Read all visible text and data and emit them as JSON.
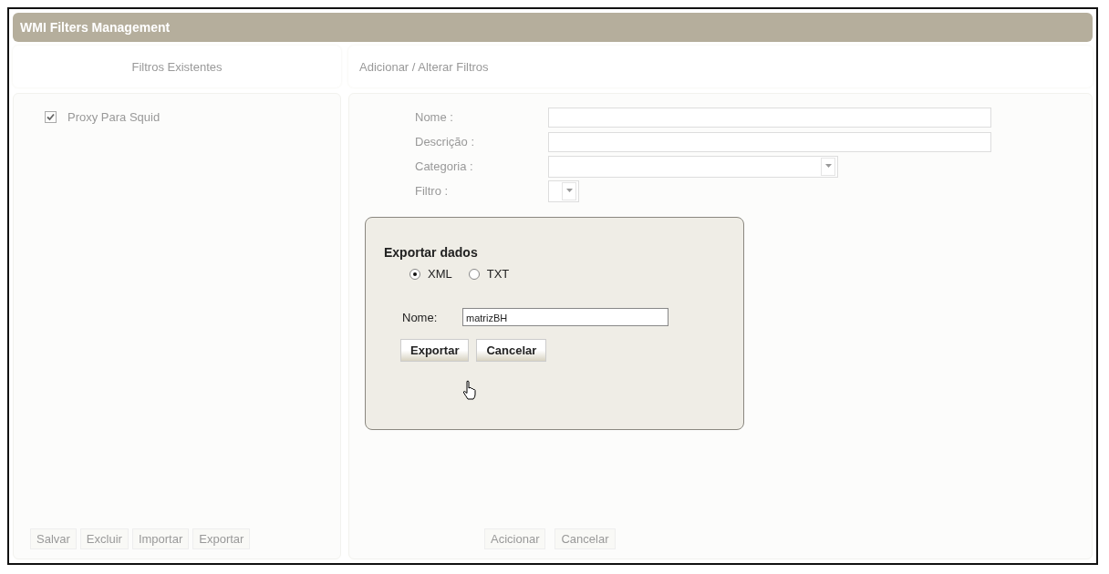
{
  "window": {
    "title": "WMI Filters Management"
  },
  "left_panel": {
    "heading": "Filtros Existentes",
    "items": [
      {
        "label": "Proxy Para Squid",
        "checked": true
      }
    ],
    "buttons": [
      "Salvar",
      "Excluir",
      "Importar",
      "Exportar"
    ]
  },
  "right_panel": {
    "heading": "Adicionar / Alterar Filtros",
    "fields": [
      {
        "label": "Nome :",
        "kind": "text"
      },
      {
        "label": "Descrição :",
        "kind": "text"
      },
      {
        "label": "Categoria :",
        "kind": "select"
      },
      {
        "label": "Filtro :",
        "kind": "small-select"
      }
    ],
    "buttons": [
      "Acicionar",
      "Cancelar"
    ]
  },
  "dialog": {
    "title": "Exportar dados",
    "formats": [
      {
        "label": "XML",
        "selected": true
      },
      {
        "label": "TXT",
        "selected": false
      }
    ],
    "name_label": "Nome:",
    "name_value": "matrizBH",
    "buttons": [
      "Exportar",
      "Cancelar"
    ]
  }
}
